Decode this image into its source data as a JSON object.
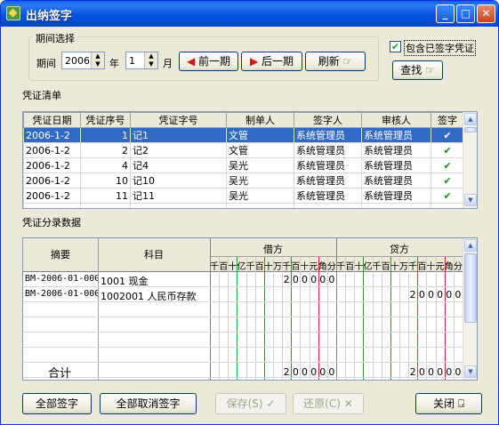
{
  "window": {
    "title": "出纳签字"
  },
  "period": {
    "group_label": "期间选择",
    "period_label": "期间",
    "year": "2006",
    "year_label": "年",
    "month": "1",
    "month_label": "月",
    "prev_label": "前一期",
    "next_label": "后一期",
    "refresh_label": "刷新"
  },
  "options": {
    "include_signed_label": "包含已签字凭证",
    "include_signed_checked": true,
    "find_label": "查找"
  },
  "voucher_list": {
    "title": "凭证清单",
    "columns": [
      "凭证日期",
      "凭证序号",
      "凭证字号",
      "制单人",
      "签字人",
      "审核人",
      "签字"
    ],
    "rows": [
      {
        "date": "2006-1-2",
        "seq": "1",
        "no": "记1",
        "maker": "文管",
        "signer": "系统管理员",
        "auditor": "系统管理员",
        "signed": "✔"
      },
      {
        "date": "2006-1-2",
        "seq": "2",
        "no": "记2",
        "maker": "文管",
        "signer": "系统管理员",
        "auditor": "系统管理员",
        "signed": "✔"
      },
      {
        "date": "2006-1-2",
        "seq": "4",
        "no": "记4",
        "maker": "吴光",
        "signer": "系统管理员",
        "auditor": "系统管理员",
        "signed": "✔"
      },
      {
        "date": "2006-1-2",
        "seq": "10",
        "no": "记10",
        "maker": "吴光",
        "signer": "系统管理员",
        "auditor": "系统管理员",
        "signed": "✔"
      },
      {
        "date": "2006-1-2",
        "seq": "11",
        "no": "记11",
        "maker": "吴光",
        "signer": "系统管理员",
        "auditor": "系统管理员",
        "signed": "✔"
      }
    ]
  },
  "entries": {
    "title": "凭证分录数据",
    "col_summary": "摘要",
    "col_account": "科目",
    "col_debit": "借方",
    "col_credit": "贷方",
    "units": [
      "千",
      "百",
      "十",
      "亿",
      "千",
      "百",
      "十",
      "万",
      "千",
      "百",
      "十",
      "元",
      "角",
      "分"
    ],
    "rows": [
      {
        "summary": "BM-2006-01-000",
        "account": "1001  现金",
        "debit": "200000",
        "credit": ""
      },
      {
        "summary": "BM-2006-01-000",
        "account": "1002001  人民币存款",
        "debit": "",
        "credit": "200000"
      }
    ],
    "total_label": "合计",
    "total_debit": "200000",
    "total_credit": "200000"
  },
  "buttons": {
    "sign_all": "全部签字",
    "unsign_all": "全部取消签字",
    "save": "保存(S)",
    "restore": "还原(C)",
    "close": "关闭"
  }
}
